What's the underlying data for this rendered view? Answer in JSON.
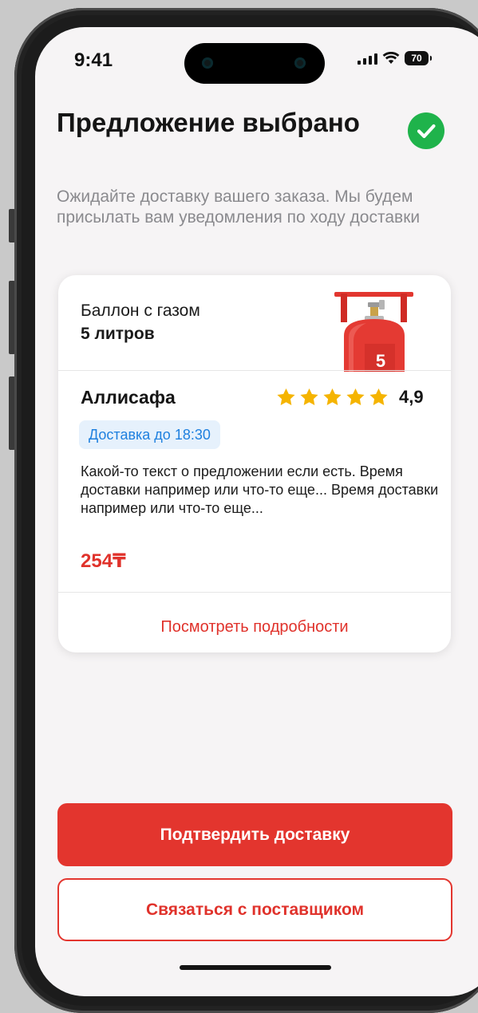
{
  "status_bar": {
    "time": "9:41",
    "battery": "70"
  },
  "header": {
    "title": "Предложение выбрано",
    "subtitle": "Ожидайте доставку вашего заказа. Мы будем присылать вам уведомления по ходу доставки"
  },
  "offer_card": {
    "product_type": "Баллон с газом",
    "product_size": "5 литров",
    "cylinder_number": "5",
    "supplier_name": "Аллисафа",
    "rating": "4,9",
    "rating_stars": 5,
    "delivery_badge": "Доставка до 18:30",
    "description": "Какой-то текст о предложении если есть. Время доставки например или  что-то еще... Время доставки например или что-то еще...",
    "price": "254₸",
    "details_link": "Посмотреть подробности"
  },
  "actions": {
    "confirm_label": "Подтвердить доставку",
    "contact_label": "Связаться с поставщиком"
  },
  "colors": {
    "accent": "#e3352e",
    "success": "#1fb34b",
    "badge_bg": "#e6f1fc",
    "badge_text": "#1f80df",
    "star": "#f5b400"
  }
}
